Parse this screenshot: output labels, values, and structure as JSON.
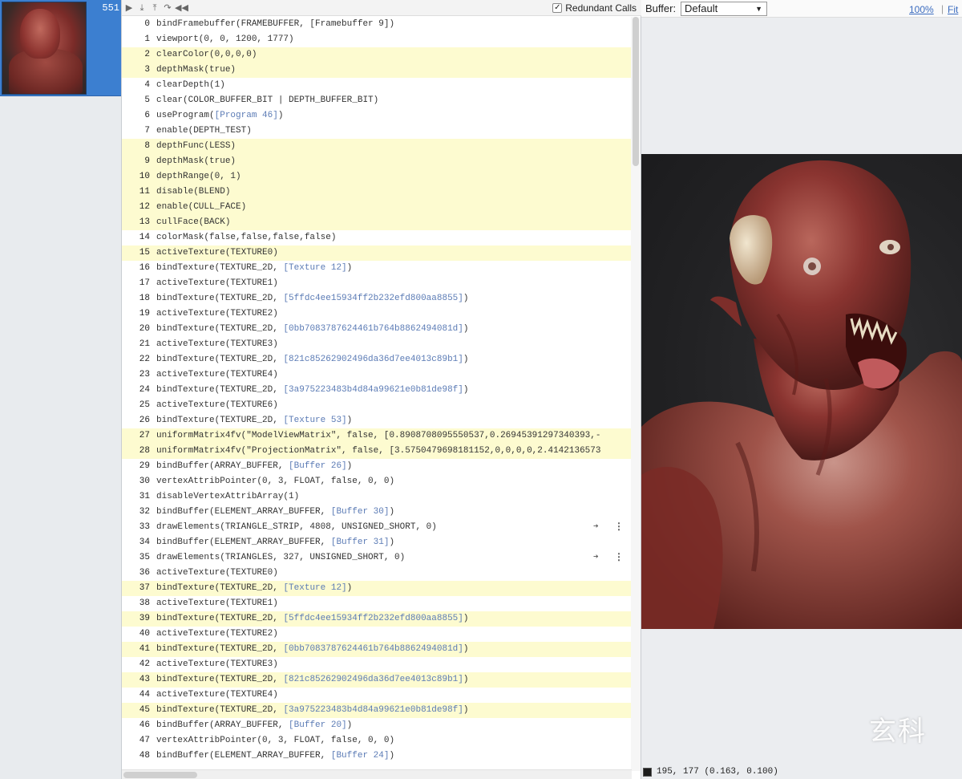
{
  "thumbnail": {
    "frame_count": "551"
  },
  "toolbar": {
    "redundant_label": "Redundant Calls",
    "redundant_checked": "✓",
    "icons": [
      "play-icon",
      "step-into-icon",
      "step-out-icon",
      "step-over-icon",
      "rewind-icon"
    ]
  },
  "viewer": {
    "buffer_label": "Buffer:",
    "buffer_value": "Default",
    "zoom": "100%",
    "separator": "|",
    "fit": "Fit",
    "pixel_readout": "195, 177 (0.163, 0.100)",
    "watermark_text": "玄科"
  },
  "calls": [
    {
      "n": "0",
      "t": "bindFramebuffer(FRAMEBUFFER, [Framebuffer 9])",
      "hl": false
    },
    {
      "n": "1",
      "t": "viewport(0, 0, 1200, 1777)",
      "hl": false
    },
    {
      "n": "2",
      "t": "clearColor(0,0,0,0)",
      "hl": true
    },
    {
      "n": "3",
      "t": "depthMask(true)",
      "hl": true
    },
    {
      "n": "4",
      "t": "clearDepth(1)",
      "hl": false
    },
    {
      "n": "5",
      "t": "clear(COLOR_BUFFER_BIT | DEPTH_BUFFER_BIT)",
      "hl": false
    },
    {
      "n": "6",
      "t": "useProgram(",
      "o": "[Program 46]",
      "e": ")",
      "hl": false
    },
    {
      "n": "7",
      "t": "enable(DEPTH_TEST)",
      "hl": false
    },
    {
      "n": "8",
      "t": "depthFunc(LESS)",
      "hl": true
    },
    {
      "n": "9",
      "t": "depthMask(true)",
      "hl": true
    },
    {
      "n": "10",
      "t": "depthRange(0, 1)",
      "hl": true
    },
    {
      "n": "11",
      "t": "disable(BLEND)",
      "hl": true
    },
    {
      "n": "12",
      "t": "enable(CULL_FACE)",
      "hl": true
    },
    {
      "n": "13",
      "t": "cullFace(BACK)",
      "hl": true
    },
    {
      "n": "14",
      "t": "colorMask(false,false,false,false)",
      "hl": false
    },
    {
      "n": "15",
      "t": "activeTexture(TEXTURE0)",
      "hl": true
    },
    {
      "n": "16",
      "t": "bindTexture(TEXTURE_2D, ",
      "o": "[Texture 12]",
      "e": ")",
      "hl": false
    },
    {
      "n": "17",
      "t": "activeTexture(TEXTURE1)",
      "hl": false
    },
    {
      "n": "18",
      "t": "bindTexture(TEXTURE_2D, ",
      "o": "[5ffdc4ee15934ff2b232efd800aa8855]",
      "e": ")",
      "hl": false
    },
    {
      "n": "19",
      "t": "activeTexture(TEXTURE2)",
      "hl": false
    },
    {
      "n": "20",
      "t": "bindTexture(TEXTURE_2D, ",
      "o": "[0bb7083787624461b764b8862494081d]",
      "e": ")",
      "hl": false
    },
    {
      "n": "21",
      "t": "activeTexture(TEXTURE3)",
      "hl": false
    },
    {
      "n": "22",
      "t": "bindTexture(TEXTURE_2D, ",
      "o": "[821c85262902496da36d7ee4013c89b1]",
      "e": ")",
      "hl": false
    },
    {
      "n": "23",
      "t": "activeTexture(TEXTURE4)",
      "hl": false
    },
    {
      "n": "24",
      "t": "bindTexture(TEXTURE_2D, ",
      "o": "[3a975223483b4d84a99621e0b81de98f]",
      "e": ")",
      "hl": false
    },
    {
      "n": "25",
      "t": "activeTexture(TEXTURE6)",
      "hl": false
    },
    {
      "n": "26",
      "t": "bindTexture(TEXTURE_2D, ",
      "o": "[Texture 53]",
      "e": ")",
      "hl": false
    },
    {
      "n": "27",
      "t": "uniformMatrix4fv(\"ModelViewMatrix\", false, [0.8908708095550537,0.26945391297340393,-",
      "hl": true
    },
    {
      "n": "28",
      "t": "uniformMatrix4fv(\"ProjectionMatrix\", false, [3.5750479698181152,0,0,0,0,2.4142136573",
      "hl": true
    },
    {
      "n": "29",
      "t": "bindBuffer(ARRAY_BUFFER, ",
      "o": "[Buffer 26]",
      "e": ")",
      "hl": false
    },
    {
      "n": "30",
      "t": "vertexAttribPointer(0, 3, FLOAT, false, 0, 0)",
      "hl": false
    },
    {
      "n": "31",
      "t": "disableVertexAttribArray(1)",
      "hl": false
    },
    {
      "n": "32",
      "t": "bindBuffer(ELEMENT_ARRAY_BUFFER, ",
      "o": "[Buffer 30]",
      "e": ")",
      "hl": false
    },
    {
      "n": "33",
      "t": "drawElements(TRIANGLE_STRIP, 4808, UNSIGNED_SHORT, 0)",
      "hl": false,
      "act": true
    },
    {
      "n": "34",
      "t": "bindBuffer(ELEMENT_ARRAY_BUFFER, ",
      "o": "[Buffer 31]",
      "e": ")",
      "hl": false
    },
    {
      "n": "35",
      "t": "drawElements(TRIANGLES, 327, UNSIGNED_SHORT, 0)",
      "hl": false,
      "act": true
    },
    {
      "n": "36",
      "t": "activeTexture(TEXTURE0)",
      "hl": false
    },
    {
      "n": "37",
      "t": "bindTexture(TEXTURE_2D, ",
      "o": "[Texture 12]",
      "e": ")",
      "hl": true
    },
    {
      "n": "38",
      "t": "activeTexture(TEXTURE1)",
      "hl": false
    },
    {
      "n": "39",
      "t": "bindTexture(TEXTURE_2D, ",
      "o": "[5ffdc4ee15934ff2b232efd800aa8855]",
      "e": ")",
      "hl": true
    },
    {
      "n": "40",
      "t": "activeTexture(TEXTURE2)",
      "hl": false
    },
    {
      "n": "41",
      "t": "bindTexture(TEXTURE_2D, ",
      "o": "[0bb7083787624461b764b8862494081d]",
      "e": ")",
      "hl": true
    },
    {
      "n": "42",
      "t": "activeTexture(TEXTURE3)",
      "hl": false
    },
    {
      "n": "43",
      "t": "bindTexture(TEXTURE_2D, ",
      "o": "[821c85262902496da36d7ee4013c89b1]",
      "e": ")",
      "hl": true
    },
    {
      "n": "44",
      "t": "activeTexture(TEXTURE4)",
      "hl": false
    },
    {
      "n": "45",
      "t": "bindTexture(TEXTURE_2D, ",
      "o": "[3a975223483b4d84a99621e0b81de98f]",
      "e": ")",
      "hl": true
    },
    {
      "n": "46",
      "t": "bindBuffer(ARRAY_BUFFER, ",
      "o": "[Buffer 20]",
      "e": ")",
      "hl": false
    },
    {
      "n": "47",
      "t": "vertexAttribPointer(0, 3, FLOAT, false, 0, 0)",
      "hl": false
    },
    {
      "n": "48",
      "t": "bindBuffer(ELEMENT_ARRAY_BUFFER, ",
      "o": "[Buffer 24]",
      "e": ")",
      "hl": false
    }
  ],
  "colors": {
    "highlight": "#fdfbd0",
    "selection": "#3c7fd0",
    "object_ref": "#5b7bb5",
    "link": "#3a6bbf"
  }
}
